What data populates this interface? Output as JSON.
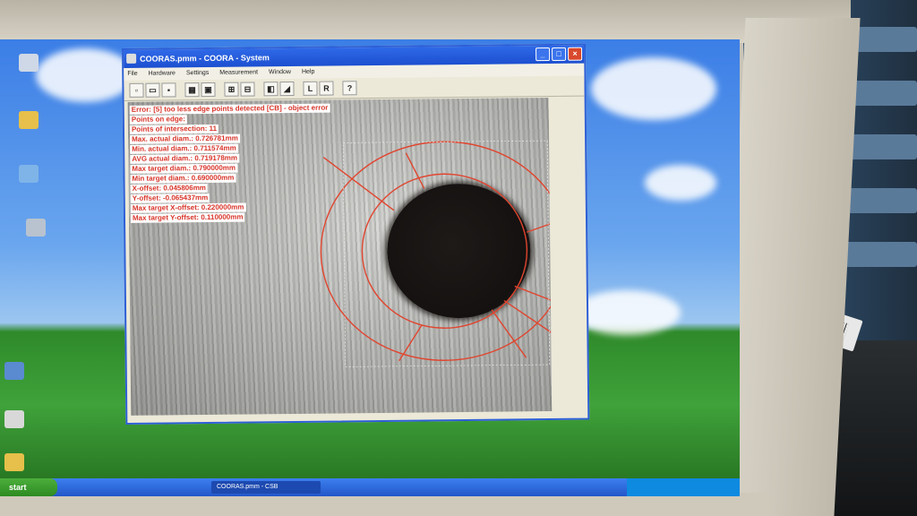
{
  "window": {
    "title": "COORAS.pmm - COORA - System",
    "controls": [
      "_",
      "□",
      "×"
    ]
  },
  "menu": [
    "File",
    "Hardware",
    "Settings",
    "Measurement",
    "Window",
    "Help"
  ],
  "toolbar": {
    "buttons": [
      {
        "name": "new-icon",
        "glyph": "▫"
      },
      {
        "name": "open-icon",
        "glyph": "▭"
      },
      {
        "name": "save-icon",
        "glyph": "▪"
      },
      {
        "name": "grid-icon",
        "glyph": "▦"
      },
      {
        "name": "capture-icon",
        "glyph": "▣"
      },
      {
        "name": "measure-icon",
        "glyph": "⊞"
      },
      {
        "name": "edge-icon",
        "glyph": "⊟"
      },
      {
        "name": "zoom-icon",
        "glyph": "◧"
      },
      {
        "name": "contrast-icon",
        "glyph": "◢"
      },
      {
        "name": "left-icon",
        "glyph": "L"
      },
      {
        "name": "right-icon",
        "glyph": "R"
      },
      {
        "name": "help-icon",
        "glyph": "?"
      }
    ]
  },
  "measurements": [
    "Error: [5] too less edge points detected [CB] - object error",
    "Points on edge:",
    "Points of intersection: 11",
    "Max. actual diam.: 0.726781mm",
    "Min. actual diam.: 0.711574mm",
    "AVG actual diam.: 0.719178mm",
    "Max target diam.: 0.790000mm",
    "Min target diam.: 0.690000mm",
    "X-offset: 0.045806mm",
    "Y-offset: -0.065437mm",
    "Max target X-offset: 0.220000mm",
    "Max target Y-offset: 0.110000mm"
  ],
  "colors": {
    "overlay": "#e0452e",
    "title_bar": "#1c4fd0",
    "text_red": "#d8352a"
  },
  "taskbar": {
    "start_label": "start",
    "task_label": "COORAS.pmm - CSB"
  }
}
